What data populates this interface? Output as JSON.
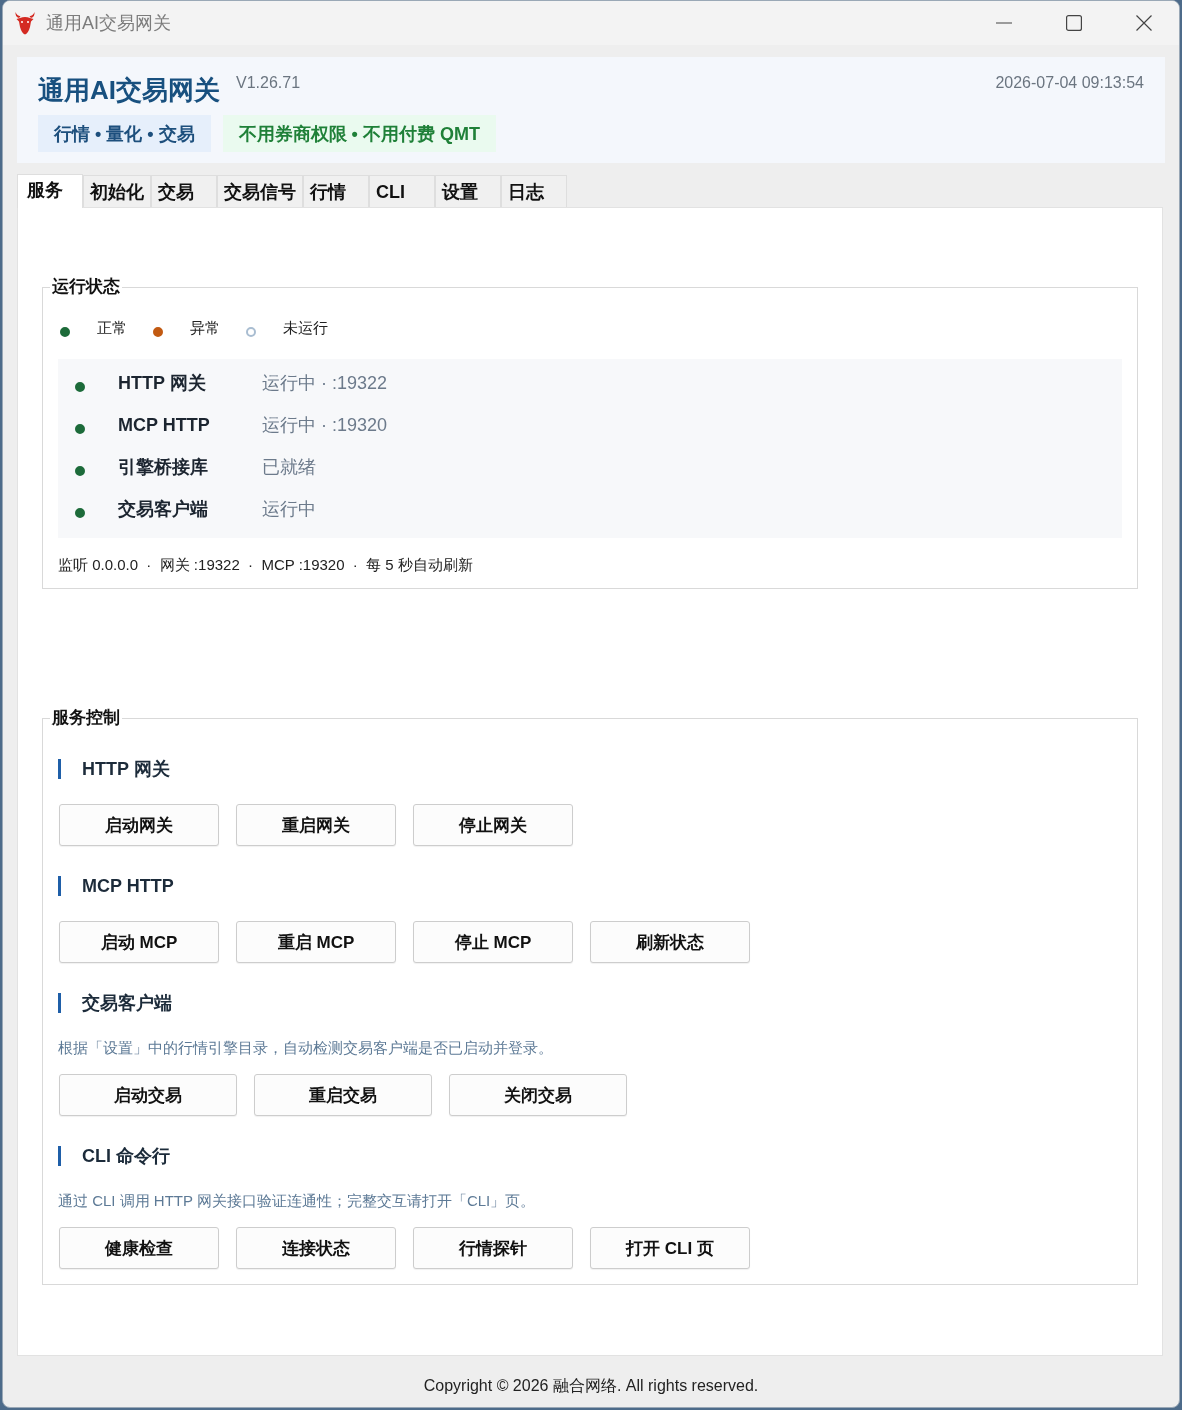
{
  "window": {
    "title": "通用AI交易网关"
  },
  "header": {
    "title": "通用AI交易网关",
    "version": "V1.26.71",
    "datetime": "2026-07-04 09:13:54",
    "badges": [
      {
        "text": "行情 • 量化 • 交易",
        "kind": "info"
      },
      {
        "text": "不用券商权限 • 不用付费 QMT",
        "kind": "success"
      }
    ]
  },
  "tabs": [
    {
      "label": "服务",
      "selected": true
    },
    {
      "label": "初始化",
      "selected": false
    },
    {
      "label": "交易",
      "selected": false
    },
    {
      "label": "交易信号",
      "selected": false
    },
    {
      "label": "行情",
      "selected": false
    },
    {
      "label": "CLI",
      "selected": false
    },
    {
      "label": "设置",
      "selected": false
    },
    {
      "label": "日志",
      "selected": false
    }
  ],
  "status_group": {
    "title": "运行状态",
    "legend": [
      {
        "label": "正常",
        "kind": "filled",
        "color": "#1d6b3a"
      },
      {
        "label": "异常",
        "kind": "filled",
        "color": "#c25a12"
      },
      {
        "label": "未运行",
        "kind": "hollow",
        "color": "#a9bdd1"
      }
    ],
    "services": [
      {
        "name": "HTTP 网关",
        "status": "运行中 · :19322",
        "color": "#1d6b3a"
      },
      {
        "name": "MCP HTTP",
        "status": "运行中 · :19320",
        "color": "#1d6b3a"
      },
      {
        "name": "引擎桥接库",
        "status": "已就绪",
        "color": "#1d6b3a"
      },
      {
        "name": "交易客户端",
        "status": "运行中",
        "color": "#1d6b3a"
      }
    ],
    "footer": "监听 0.0.0.0  ·  网关 :19322  ·  MCP :19320  ·  每 5 秒自动刷新"
  },
  "control_group": {
    "title": "服务控制",
    "sections": [
      {
        "heading": "HTTP 网关",
        "buttons": [
          "启动网关",
          "重启网关",
          "停止网关"
        ]
      },
      {
        "heading": "MCP HTTP",
        "buttons": [
          "启动 MCP",
          "重启 MCP",
          "停止 MCP",
          "刷新状态"
        ]
      },
      {
        "heading": "交易客户端",
        "description": "根据「设置」中的行情引擎目录，自动检测交易客户端是否已启动并登录。",
        "buttons": [
          "启动交易",
          "重启交易",
          "关闭交易"
        ]
      },
      {
        "heading": "CLI 命令行",
        "description": "通过 CLI 调用 HTTP 网关接口验证连通性；完整交互请打开「CLI」页。",
        "buttons": [
          "健康检查",
          "连接状态",
          "行情探针",
          "打开 CLI 页"
        ]
      }
    ]
  },
  "copyright": "Copyright © 2026 融合网络. All rights reserved."
}
